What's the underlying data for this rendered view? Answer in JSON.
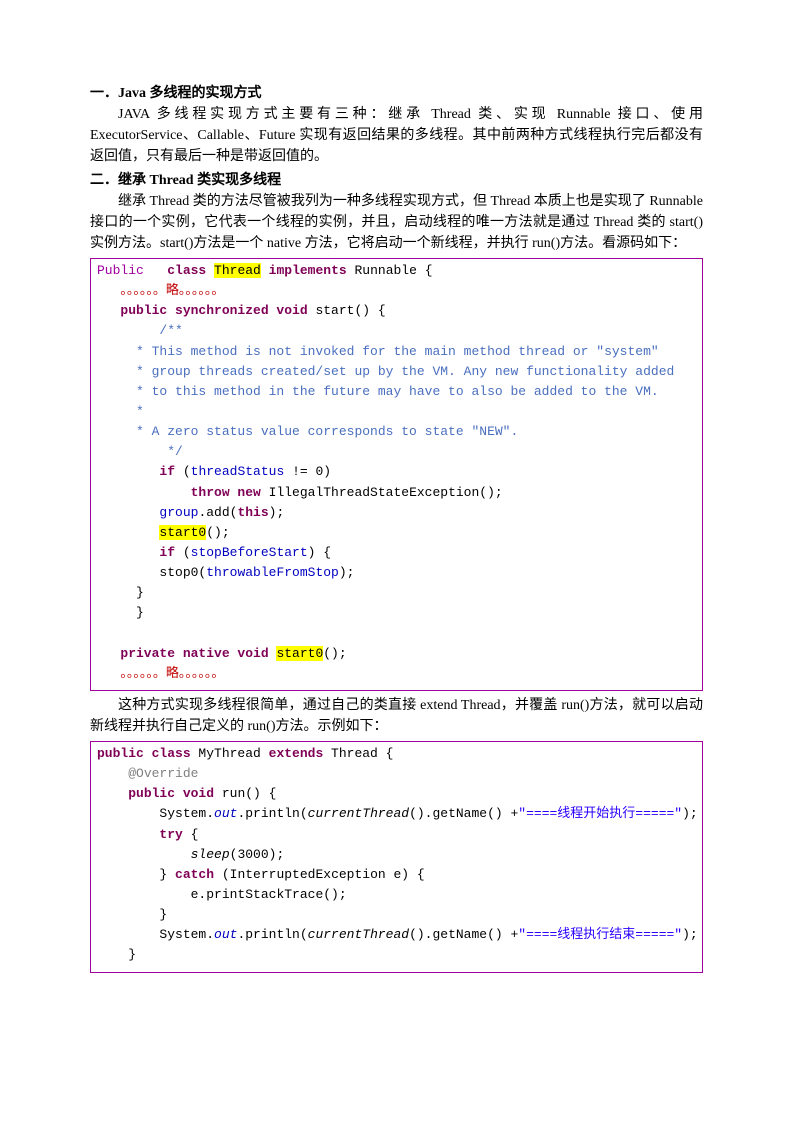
{
  "heading1": "一．Java 多线程的实现方式",
  "para1": "JAVA 多线程实现方式主要有三种：继承 Thread 类、实现 Runnable 接口、使用 ExecutorService、Callable、Future 实现有返回结果的多线程。其中前两种方式线程执行完后都没有返回值，只有最后一种是带返回值的。",
  "heading2": "二．继承 Thread 类实现多线程",
  "para2": "继承 Thread 类的方法尽管被我列为一种多线程实现方式，但 Thread 本质上也是实现了 Runnable 接口的一个实例，它代表一个线程的实例，并且，启动线程的唯一方法就是通过 Thread 类的 start()实例方法。start()方法是一个 native 方法，它将启动一个新线程，并执行 run()方法。看源码如下：",
  "code1": {
    "l01_pre": "Public",
    "l01_cls": "class",
    "l01_thread": "Thread",
    "l01_impl": "implements",
    "l01_runnable": " Runnable {",
    "l02": "。。。。。。略。。。。。。",
    "l03a": "public synchronized void",
    "l03b": " start() {",
    "l04": "        /**",
    "l05": "     * This method is not invoked for the main method thread or \"system\"",
    "l06": "     * group threads created/set up by the VM. Any new functionality added",
    "l07": "     * to this method in the future may have to also be added to the VM.",
    "l08": "     *",
    "l09": "     * A zero status value corresponds to state \"NEW\".",
    "l10": "         */",
    "l11_if": "if",
    "l11_rest": " (",
    "l11_f": "threadStatus",
    "l11_end": " != 0)",
    "l12_throw": "throw new",
    "l12_rest": " IllegalThreadStateException();",
    "l13_g": "group",
    "l13_add": ".add(",
    "l13_this": "this",
    "l13_end": ");",
    "l14": "start0",
    "l14_end": "();",
    "l15_if": "if",
    "l15_rest": " (",
    "l15_f": "stopBeforeStart",
    "l15_end": ") {",
    "l16_a": "stop0(",
    "l16_f": "throwableFromStop",
    "l16_end": ");",
    "l17": "}",
    "l18": "}",
    "l20a": "private native void ",
    "l20b": "start0",
    "l20c": "();",
    "l21": "。。。。。。略。。。。。。"
  },
  "para3": "这种方式实现多线程很简单，通过自己的类直接 extend Thread，并覆盖 run()方法，就可以启动新线程并执行自己定义的 run()方法。示例如下：",
  "code2": {
    "l01a": "public class",
    "l01b": " MyThread ",
    "l01c": "extends",
    "l01d": " Thread {",
    "l02": "@Override",
    "l03a": "public void",
    "l03b": " run() {",
    "l04a": "System.",
    "l04out": "out",
    "l04b": ".println(",
    "l04c": "currentThread",
    "l04d": "().getName() +",
    "l04s": "\"====线程开始执行=====\"",
    "l04e": ");",
    "l05": "try",
    "l05b": " {",
    "l06": "sleep",
    "l06b": "(3000);",
    "l07a": "} ",
    "l07b": "catch",
    "l07c": " (InterruptedException e) {",
    "l08": "e.printStackTrace();",
    "l09": "}",
    "l10a": "System.",
    "l10out": "out",
    "l10b": ".println(",
    "l10c": "currentThread",
    "l10d": "().getName() +",
    "l10s": "\"====线程执行结束=====\"",
    "l10e": ");",
    "l11": "}"
  }
}
